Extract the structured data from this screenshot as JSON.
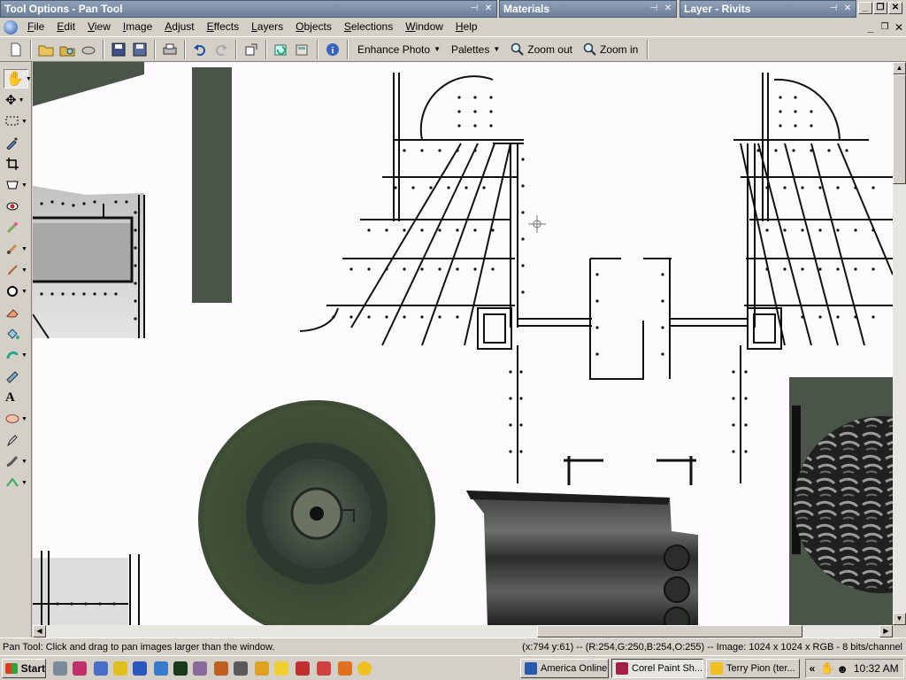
{
  "palettes": {
    "tool_options": "Tool Options - Pan Tool",
    "materials": "Materials",
    "layer": "Layer - Rivits",
    "pin_icon": "pin-icon",
    "close_glyph": "×",
    "pin_glyph": "-ᵖ"
  },
  "menu": [
    "File",
    "Edit",
    "View",
    "Image",
    "Adjust",
    "Effects",
    "Layers",
    "Objects",
    "Selections",
    "Window",
    "Help"
  ],
  "toolbar": {
    "enhance_photo": "Enhance Photo",
    "palettes": "Palettes",
    "zoom_out": "Zoom out",
    "zoom_in": "Zoom in"
  },
  "status": {
    "left": "Pan Tool: Click and drag to pan images larger than the window.",
    "right": "(x:794 y:61) -- (R:254,G:250,B:254,O:255) -- Image:  1024 x 1024 x RGB - 8 bits/channel"
  },
  "taskbar": {
    "start": "Start",
    "tasks": [
      "America  Online",
      "Corel Paint Sh...",
      "Terry Pion (ter..."
    ],
    "tray_chevron": "«",
    "clock": "10:32 AM"
  },
  "colors": {
    "canvas_bg": "#fefbfe",
    "wheel_green": "#3d4d35",
    "armor_gray": "#4a5448",
    "tread_dark": "#2a2d2a"
  }
}
